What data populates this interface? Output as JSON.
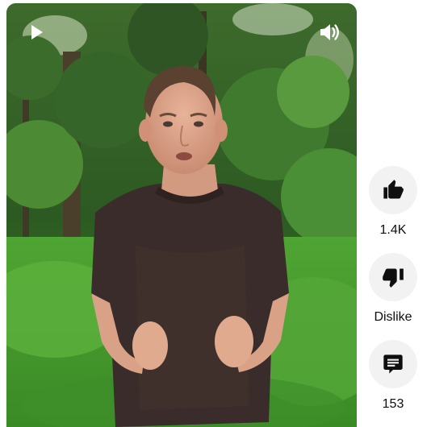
{
  "video": {
    "play_icon": "play-icon",
    "volume_icon": "volume-icon"
  },
  "actions": {
    "like": {
      "icon": "thumbs-up-icon",
      "label": "1.4K"
    },
    "dislike": {
      "icon": "thumbs-down-icon",
      "label": "Dislike"
    },
    "comments": {
      "icon": "comment-icon",
      "label": "153"
    }
  },
  "colors": {
    "button_bg": "#f2f2f2",
    "icon": "#0f0f0f",
    "overlay_icon": "#ffffff"
  }
}
